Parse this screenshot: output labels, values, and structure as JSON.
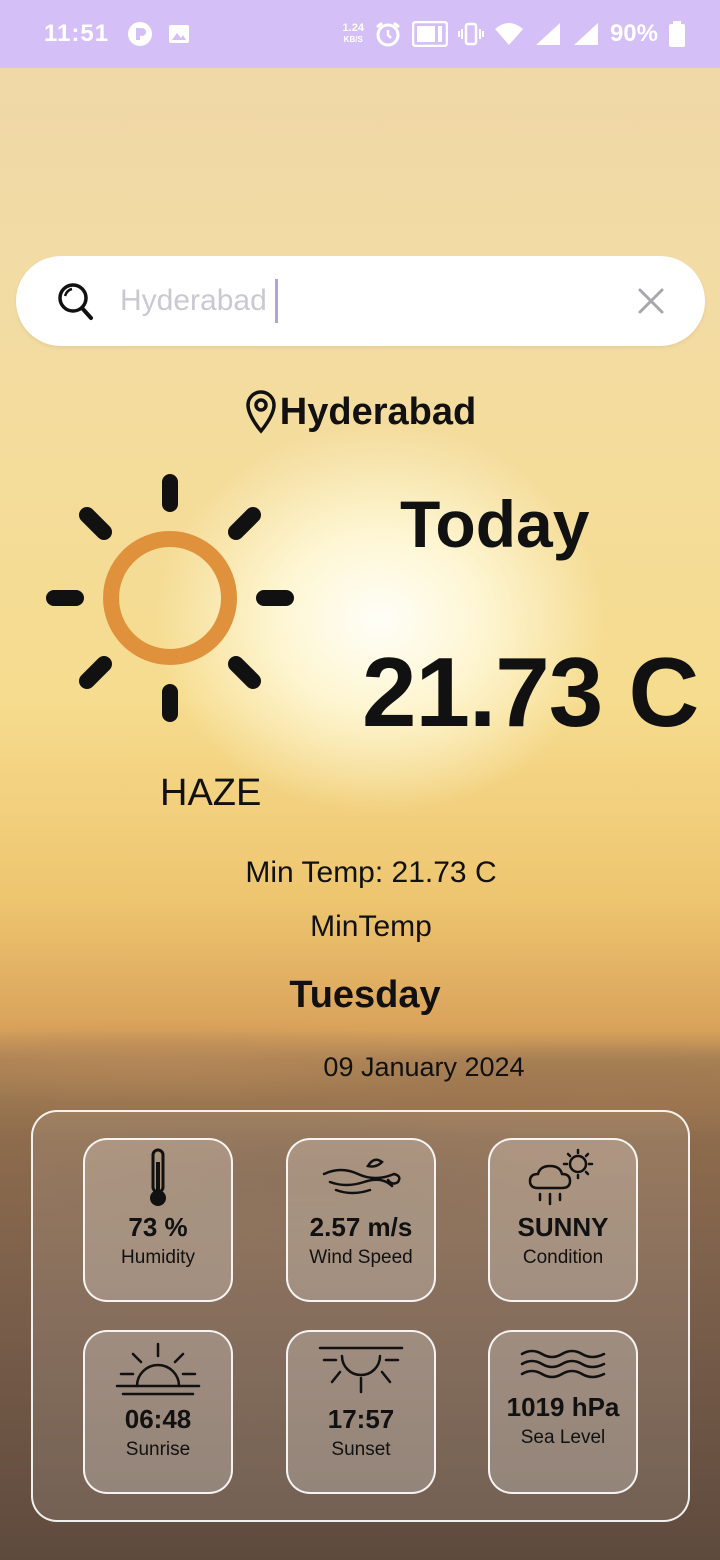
{
  "status_bar": {
    "time": "11:51",
    "speed_value": "1.24",
    "speed_unit": "KB/S",
    "battery": "90%"
  },
  "search": {
    "value": "Hyderabad",
    "icons": [
      "search-icon",
      "close-icon"
    ]
  },
  "location": "Hyderabad",
  "weather": {
    "day_label": "Today",
    "temperature": "21.73 C",
    "condition": "HAZE",
    "min_temp": "Min Temp: 21.73 C",
    "min_temp_label": "MinTemp",
    "weekday": "Tuesday",
    "date": "09 January 2024",
    "sun_color": "#e0913c"
  },
  "details": [
    {
      "value": "73 %",
      "label": "Humidity",
      "icon": "thermometer-icon"
    },
    {
      "value": "2.57 m/s",
      "label": "Wind Speed",
      "icon": "wind-icon"
    },
    {
      "value": "SUNNY",
      "label": "Condition",
      "icon": "cloud-rain-sun-icon"
    },
    {
      "value": "06:48",
      "label": "Sunrise",
      "icon": "sunrise-icon"
    },
    {
      "value": "17:57",
      "label": "Sunset",
      "icon": "sunset-icon"
    },
    {
      "value": "1019 hPa",
      "label": "Sea Level",
      "icon": "waves-icon"
    }
  ]
}
